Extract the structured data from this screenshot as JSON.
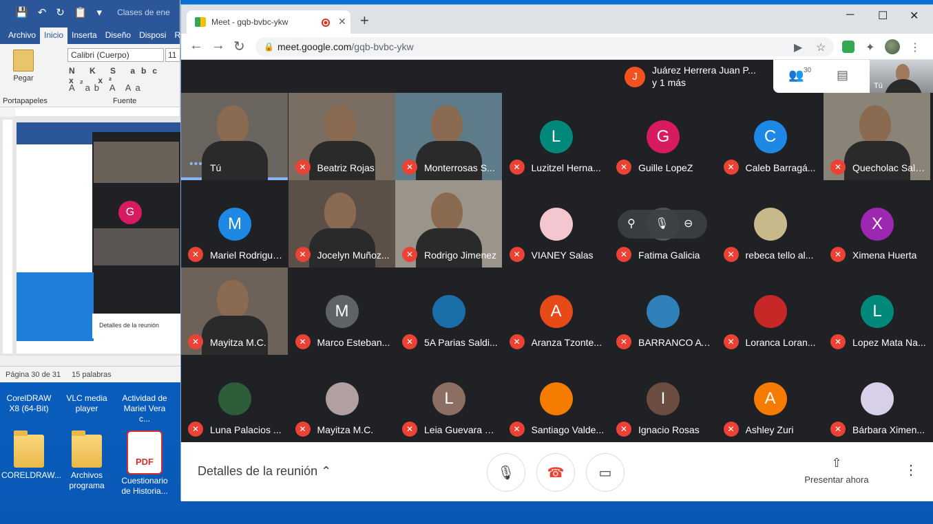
{
  "word": {
    "doc_title": "Clases de ene",
    "tabs": [
      "Archivo",
      "Inicio",
      "Inserta",
      "Diseño",
      "Disposi",
      "Ref"
    ],
    "active_tab": "Inicio",
    "paste_label": "Pegar",
    "font_name": "Calibri (Cuerpo)",
    "font_size": "11",
    "group_clipboard": "Portapapeles",
    "group_font": "Fuente",
    "status_page": "Página 30 de 31",
    "status_words": "15 palabras",
    "mini_details": "Detalles de la reunión"
  },
  "desktop": {
    "icons_top": [
      "CorelDRAW X8 (64-Bit)",
      "VLC media player",
      "Actividad de Mariel Vera c..."
    ],
    "icons_bottom": [
      "CORELDRAW...",
      "Archivos programa",
      "Cuestionario de Historia..."
    ],
    "pdf_label": "PDF"
  },
  "browser": {
    "tab_title": "Meet - gqb-bvbc-ykw",
    "url_domain": "meet.google.com",
    "url_path": "/gqb-bvbc-ykw"
  },
  "meet": {
    "presenter_initial": "J",
    "presenter_name": "Juárez Herrera Juan P...",
    "presenter_more": "y 1 más",
    "participant_count": "30",
    "self_label": "Tú",
    "tiles": [
      {
        "name": "Tú",
        "kind": "video",
        "active": true
      },
      {
        "name": "Beatriz Rojas",
        "kind": "video"
      },
      {
        "name": "Monterrosas S...",
        "kind": "video"
      },
      {
        "name": "Luzitzel Herna...",
        "initial": "L",
        "color": "#00897b"
      },
      {
        "name": "Guille LopeZ",
        "initial": "G",
        "color": "#d81b60"
      },
      {
        "name": "Caleb Barragá...",
        "initial": "C",
        "color": "#1e88e5"
      },
      {
        "name": "Quecholac Sala...",
        "kind": "video"
      },
      {
        "name": "Mariel Rodrigue...",
        "initial": "M",
        "color": "#1e88e5"
      },
      {
        "name": "Jocelyn Muñoz...",
        "kind": "video"
      },
      {
        "name": "Rodrigo Jimenez",
        "kind": "video"
      },
      {
        "name": "VIANEY Salas",
        "kind": "photo",
        "color": "#f4c7d0"
      },
      {
        "name": "Fatima Galicia",
        "kind": "photo",
        "color": "#555"
      },
      {
        "name": "rebeca tello al...",
        "kind": "photo",
        "color": "#c8b98a"
      },
      {
        "name": "Ximena Huerta",
        "initial": "X",
        "color": "#9c27b0"
      },
      {
        "name": "Mayitza M.C.",
        "kind": "video"
      },
      {
        "name": "Marco Esteban...",
        "initial": "M",
        "color": "#5f6368"
      },
      {
        "name": "5A Parias Saldi...",
        "kind": "photo",
        "color": "#1b6fa8"
      },
      {
        "name": "Aranza Tzonte...",
        "initial": "A",
        "color": "#e64a19"
      },
      {
        "name": "BARRANCO AT...",
        "kind": "photo",
        "color": "#2f7fb8"
      },
      {
        "name": "Loranca Loran...",
        "kind": "photo",
        "color": "#c62828"
      },
      {
        "name": "Lopez Mata Na...",
        "initial": "L",
        "color": "#00897b"
      },
      {
        "name": "Luna Palacios ...",
        "kind": "photo",
        "color": "#2e5d3a"
      },
      {
        "name": "Mayitza M.C.",
        "kind": "photo",
        "color": "#b0a0a0"
      },
      {
        "name": "Leia Guevara Y ...",
        "initial": "L",
        "color": "#8d6e63"
      },
      {
        "name": "Santiago Valde...",
        "kind": "photo",
        "color": "#f57c00"
      },
      {
        "name": "Ignacio Rosas",
        "initial": "I",
        "color": "#6d4c41"
      },
      {
        "name": "Ashley Zuri",
        "initial": "A",
        "color": "#f57c00"
      },
      {
        "name": "Bárbara Ximen...",
        "kind": "photo",
        "color": "#d8d0e8"
      }
    ],
    "details_label": "Detalles de la reunión",
    "present_label": "Presentar ahora"
  }
}
